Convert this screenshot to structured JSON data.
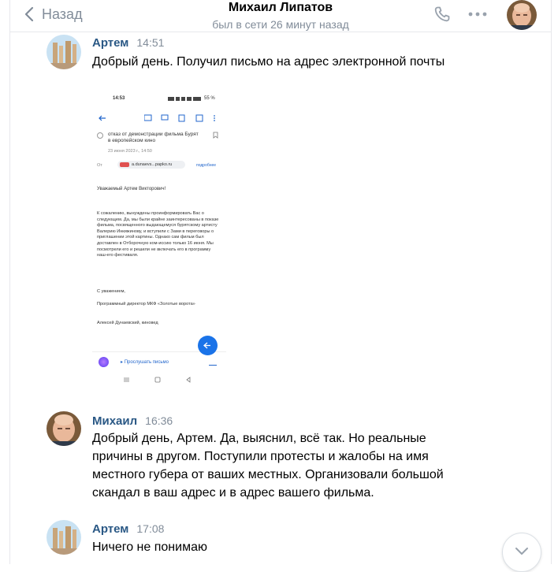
{
  "header": {
    "back_label": "Назад",
    "title": "Михаил Липатов",
    "status": "был в сети 26 минут назад"
  },
  "messages": [
    {
      "author": "Артем",
      "time": "14:51",
      "text": "Добрый день. Получил письмо на адрес электронной почты"
    },
    {
      "author": "Михаил",
      "time": "16:36",
      "text": "Добрый день, Артем. Да, выяснил, всё так. Но реальные причины в другом. Поступили протесты и жалобы на имя местного губера от ваших местных. Организовали большой скандал в ваш адрес и в адрес вашего фильма."
    },
    {
      "author": "Артем",
      "time": "17:08",
      "text": "Ничего не понимаю"
    }
  ],
  "attachment": {
    "status_time": "14:53",
    "battery": "55 %",
    "subject": "отказ от демонстрации фильма Бурят в европейском кино",
    "date": "23 июня 2023 г., 14:50",
    "from_label": "От",
    "from_address": "a.dunaevs...papko.ru",
    "details_link": "подробнее",
    "greeting": "Уважаемый Артем Викторович!",
    "body": "К сожалению, вынуждены проинформировать Вас о следующем. Да, мы были крайне заинтересованы в показе фильма, посвященного выдающемуся бурятскому артисту Валерию Инкижинову, и вступили с Зами в переговоры о приглашении этой картины. Однако сам фильм был доставлен в Отборочную ком-иссию только 16 июня. Мы посмотрели его и решили не включать его в программу наш-его фестиваля.",
    "regards": "С уважением,",
    "signature": "Программный директор МКФ «Золотые ворота»",
    "signature_name": "Алексей Дунаевский, киновед",
    "listen_label": "Прослушать письмо"
  }
}
